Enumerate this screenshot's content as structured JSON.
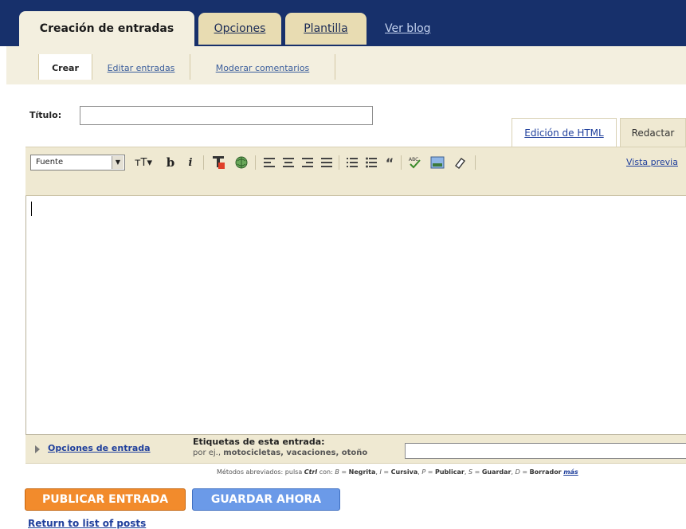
{
  "top_tabs": {
    "creation": "Creación de entradas",
    "options": "Opciones",
    "template": "Plantilla",
    "view_blog": "Ver blog"
  },
  "sub_tabs": {
    "create": "Crear",
    "edit_posts": "Editar entradas",
    "moderate": "Moderar comentarios"
  },
  "post": {
    "title_label": "Título:",
    "title_value": ""
  },
  "mode_tabs": {
    "html": "Edición de HTML",
    "compose": "Redactar"
  },
  "toolbar": {
    "font_select": "Fuente",
    "font_size_glyph": "тT▾",
    "bold": "b",
    "italic": "i",
    "preview": "Vista previa"
  },
  "bottom": {
    "entry_options": "Opciones de entrada",
    "labels_title": "Etiquetas de esta entrada:",
    "labels_example_prefix": "por ej.,",
    "labels_example_values": "motocicletas, vacaciones, otoño",
    "labels_value": ""
  },
  "shortcuts": {
    "prefix": "Métodos abreviados: pulsa",
    "ctrl": "Ctrl",
    "con": "con:",
    "b_key": "B",
    "b_label": "Negrita",
    "i_key": "I",
    "i_label": "Cursiva",
    "p_key": "P",
    "p_label": "Publicar",
    "s_key": "S",
    "s_label": "Guardar",
    "d_key": "D",
    "d_label": "Borrador",
    "more": "más"
  },
  "buttons": {
    "publish": "PUBLICAR ENTRADA",
    "save": "GUARDAR AHORA"
  },
  "return_link": "Return to list of posts"
}
